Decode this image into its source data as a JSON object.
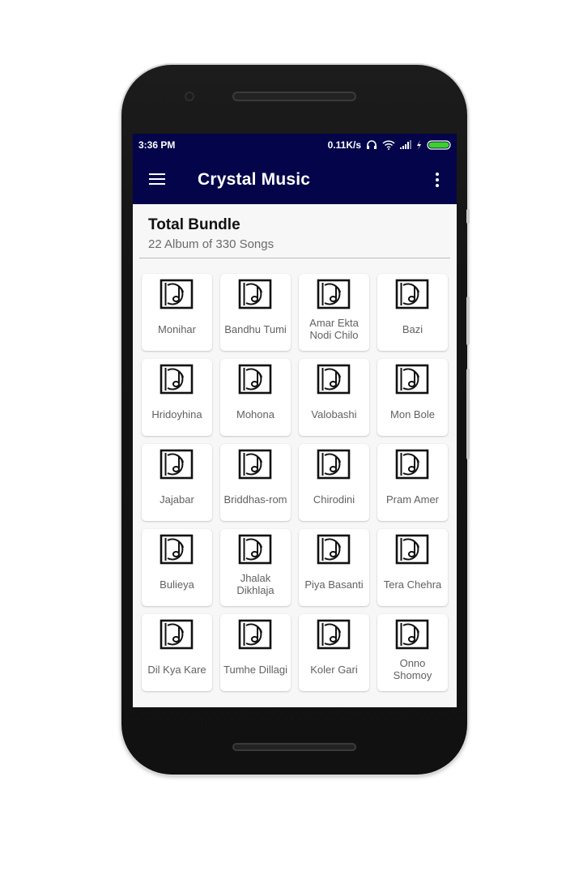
{
  "status_bar": {
    "time": "3:36 PM",
    "network_speed": "0.11K/s",
    "icons": [
      "headset-icon",
      "wifi-icon",
      "signal-icon",
      "charging-icon",
      "battery-icon"
    ],
    "battery_color": "#3ccf2e"
  },
  "app_bar": {
    "title": "Crystal Music",
    "background_color": "#04044a",
    "menu_icon": "hamburger-menu-icon",
    "overflow_icon": "more-vertical-icon"
  },
  "bundle": {
    "title": "Total Bundle",
    "subtitle": "22 Album of 330 Songs"
  },
  "albums": [
    {
      "label": "Monihar",
      "icon": "music-album-icon"
    },
    {
      "label": "Bandhu Tumi",
      "icon": "music-album-icon"
    },
    {
      "label": "Amar Ekta Nodi Chilo",
      "icon": "music-album-icon"
    },
    {
      "label": "Bazi",
      "icon": "music-album-icon"
    },
    {
      "label": "Hridoyhina",
      "icon": "music-album-icon"
    },
    {
      "label": "Mohona",
      "icon": "music-album-icon"
    },
    {
      "label": "Valobashi",
      "icon": "music-album-icon"
    },
    {
      "label": "Mon Bole",
      "icon": "music-album-icon"
    },
    {
      "label": "Jajabar",
      "icon": "music-album-icon"
    },
    {
      "label": "Briddhas-rom",
      "icon": "music-album-icon"
    },
    {
      "label": "Chirodini",
      "icon": "music-album-icon"
    },
    {
      "label": "Pram Amer",
      "icon": "music-album-icon"
    },
    {
      "label": "Bulieya",
      "icon": "music-album-icon"
    },
    {
      "label": "Jhalak Dikhlaja",
      "icon": "music-album-icon"
    },
    {
      "label": "Piya Basanti",
      "icon": "music-album-icon"
    },
    {
      "label": "Tera Chehra",
      "icon": "music-album-icon"
    },
    {
      "label": "Dil Kya Kare",
      "icon": "music-album-icon"
    },
    {
      "label": "Tumhe Dillagi",
      "icon": "music-album-icon"
    },
    {
      "label": "Koler Gari",
      "icon": "music-album-icon"
    },
    {
      "label": "Onno Shomoy",
      "icon": "music-album-icon"
    }
  ]
}
